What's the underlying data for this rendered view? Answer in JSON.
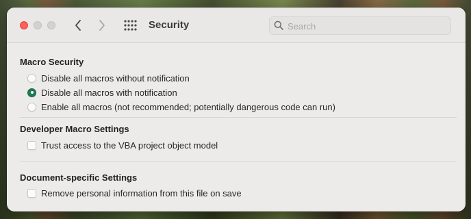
{
  "window": {
    "title": "Security",
    "search": {
      "placeholder": "Search",
      "value": ""
    }
  },
  "toolbar": {
    "icons": [
      "back-chevron-icon",
      "forward-chevron-icon",
      "grid-icon",
      "search-icon"
    ]
  },
  "sections": {
    "macro_security": {
      "title": "Macro Security",
      "options": [
        {
          "label": "Disable all macros without notification",
          "selected": false
        },
        {
          "label": "Disable all macros with notification",
          "selected": true
        },
        {
          "label": "Enable all macros (not recommended; potentially dangerous code can run)",
          "selected": false
        }
      ]
    },
    "developer": {
      "title": "Developer Macro Settings",
      "trust_label": "Trust access to the VBA project object model",
      "trust_checked": false
    },
    "document": {
      "title": "Document-specific Settings",
      "remove_label": "Remove personal information from this file on save",
      "remove_checked": false
    }
  },
  "colors": {
    "accent": "#1f7a52",
    "close_button": "#fe5f57",
    "window_background": "#ecebea"
  }
}
